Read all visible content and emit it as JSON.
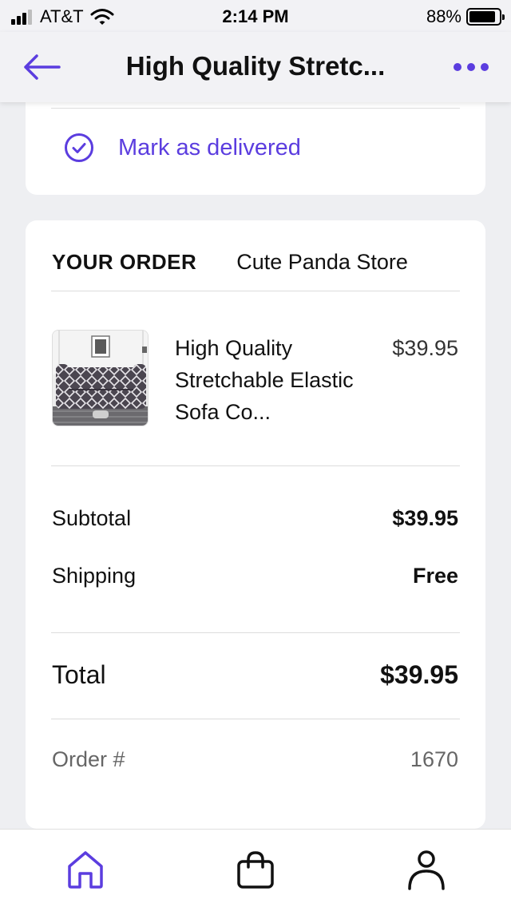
{
  "status_bar": {
    "carrier": "AT&T",
    "time": "2:14 PM",
    "battery_percent": "88%",
    "battery_level": 0.88,
    "signal_bars": 3,
    "icons": [
      "cellular-signal-icon",
      "wifi-icon",
      "battery-icon"
    ]
  },
  "nav": {
    "title": "High Quality Stretc...",
    "back_icon": "arrow-left-icon",
    "more_icon": "more-dots-icon"
  },
  "delivery": {
    "label": "Mark as delivered",
    "icon": "check-circle-icon"
  },
  "order": {
    "heading": "YOUR ORDER",
    "store": "Cute Panda Store",
    "item": {
      "name": "High Quality Stretchable Elastic Sofa Co...",
      "price": "$39.95",
      "image": "sofa-cover-thumbnail"
    },
    "subtotal_label": "Subtotal",
    "subtotal_value": "$39.95",
    "shipping_label": "Shipping",
    "shipping_value": "Free",
    "total_label": "Total",
    "total_value": "$39.95",
    "order_number_label": "Order #",
    "order_number_value": "1670"
  },
  "tab_bar": {
    "tabs": [
      "home-icon",
      "shopping-bag-icon",
      "account-icon"
    ],
    "active": "home-icon"
  },
  "colors": {
    "accent": "#5b3ddf",
    "background": "#eeeff2",
    "card": "#ffffff",
    "text": "#111111",
    "muted": "#666666"
  }
}
